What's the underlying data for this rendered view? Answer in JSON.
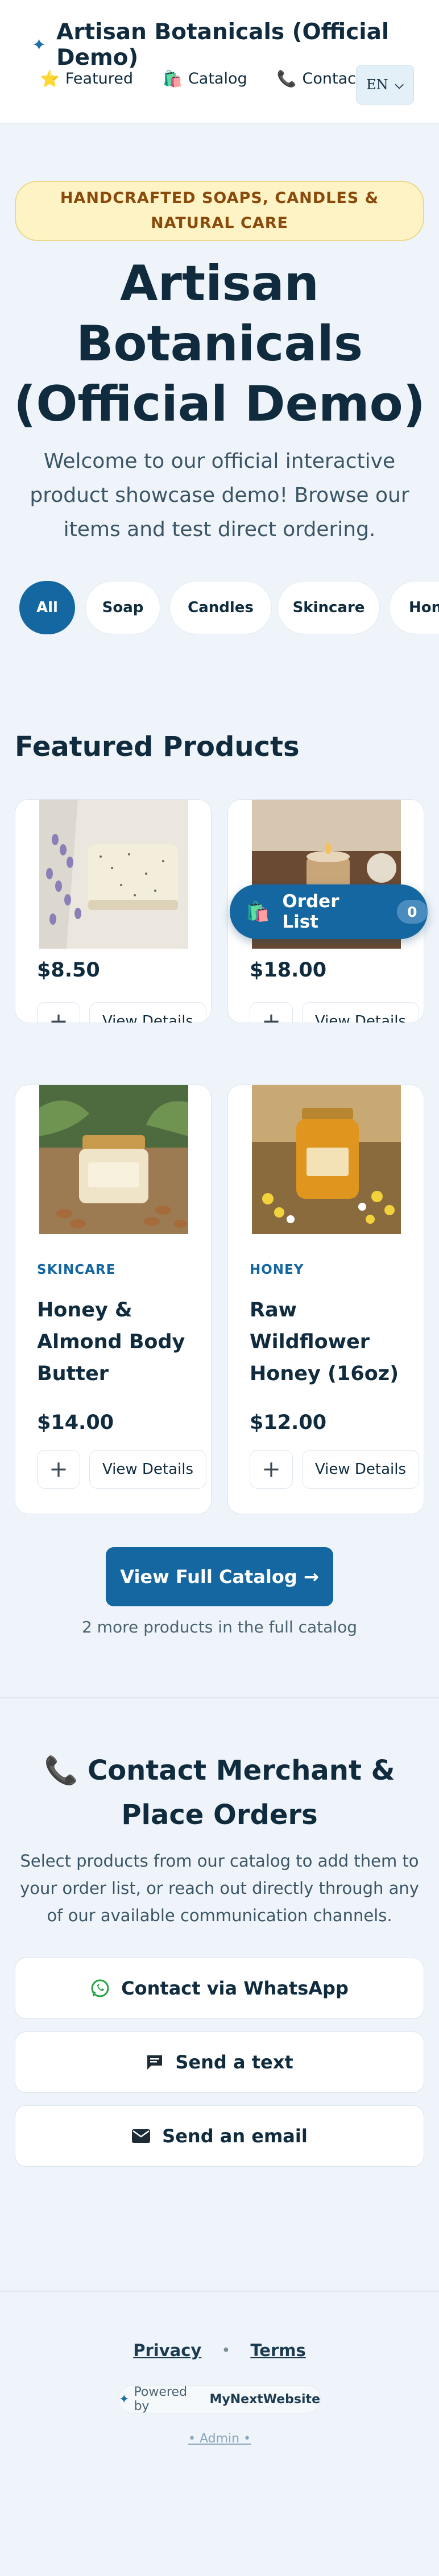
{
  "header": {
    "brand_icon": "sparkle-icon",
    "title": "Artisan Botanicals (Official Demo)",
    "nav": [
      {
        "icon": "⭐",
        "label": "Featured"
      },
      {
        "icon": "🛍️",
        "label": "Catalog"
      },
      {
        "icon": "📞",
        "label": "Contact"
      }
    ],
    "language": "EN"
  },
  "hero": {
    "badge": "HANDCRAFTED SOAPS, CANDLES & NATURAL CARE",
    "title": "Artisan Botanicals (Official Demo)",
    "subtitle": "Welcome to our official interactive product showcase demo! Browse our items and test direct ordering."
  },
  "filters": {
    "items": [
      "All",
      "Soap",
      "Candles",
      "Skincare",
      "Honey"
    ],
    "active": "All"
  },
  "featured": {
    "title": "Featured Products",
    "products": [
      {
        "category": "",
        "name": "",
        "price": "$8.50",
        "image": "soap-bar-with-lavender"
      },
      {
        "category": "",
        "name": "",
        "price": "$18.00",
        "image": "candle-on-tray"
      },
      {
        "category": "SKINCARE",
        "name": "Honey & Almond Body Butter",
        "price": "$14.00",
        "image": "body-butter-jar-with-almonds"
      },
      {
        "category": "HONEY",
        "name": "Raw Wildflower Honey (16oz)",
        "price": "$12.00",
        "image": "honey-jar-with-wildflowers"
      }
    ],
    "add_symbol": "+",
    "view_label": "View Details",
    "order_list": {
      "label": "Order List",
      "count": "0"
    },
    "catalog_button": "View Full Catalog →",
    "more_note": "2 more products in the full catalog"
  },
  "contact": {
    "title": "📞 Contact Merchant & Place Orders",
    "subtitle": "Select products from our catalog to add them to your order list, or reach out directly through any of our available communication channels.",
    "buttons": [
      {
        "icon": "whatsapp-icon",
        "label": "Contact via WhatsApp"
      },
      {
        "icon": "message-icon",
        "label": "Send a text"
      },
      {
        "icon": "mail-icon",
        "label": "Send an email"
      }
    ]
  },
  "footer": {
    "privacy": "Privacy",
    "terms": "Terms",
    "powered_prefix": "Powered by",
    "powered_brand": "MyNextWebsite",
    "admin": "• Admin •"
  },
  "colors": {
    "primary": "#1467a0",
    "background": "#eef4f9",
    "badge_bg": "#fdf3c4",
    "badge_text": "#8a4a0c",
    "whatsapp": "#25a244"
  }
}
